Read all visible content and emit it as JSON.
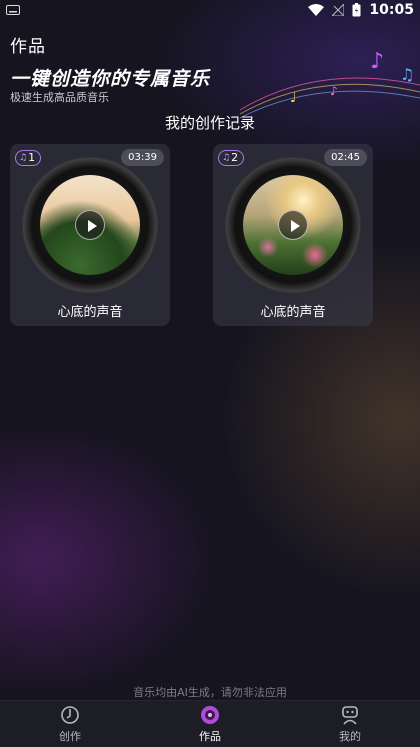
{
  "status_bar": {
    "time": "10:05"
  },
  "header": {
    "title": "作品"
  },
  "hero": {
    "title": "一键创造你的专属音乐",
    "subtitle": "极速生成高品质音乐"
  },
  "section": {
    "title": "我的创作记录"
  },
  "cards": [
    {
      "index": "1",
      "duration": "03:39",
      "title": "心底的声音"
    },
    {
      "index": "2",
      "duration": "02:45",
      "title": "心底的声音"
    }
  ],
  "footer": {
    "note": "音乐均由AI生成，请勿非法应用"
  },
  "nav": {
    "items": [
      {
        "label": "创作",
        "icon": "create-icon"
      },
      {
        "label": "作品",
        "icon": "works-disc-icon",
        "active": true
      },
      {
        "label": "我的",
        "icon": "profile-robot-icon"
      }
    ]
  },
  "colors": {
    "accent": "#b04bd8",
    "background": "#15141f",
    "badge_border": "#a77be8"
  }
}
